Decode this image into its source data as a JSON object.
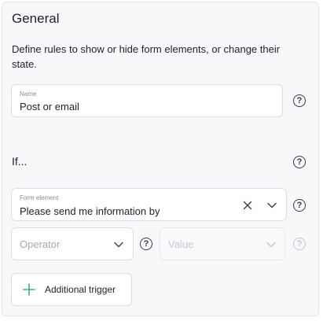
{
  "section": {
    "title": "General",
    "description": "Define rules to show or hide form elements, or change their state."
  },
  "name_field": {
    "label": "Name",
    "value": "Post or email"
  },
  "if_section": {
    "label": "If..."
  },
  "form_element_field": {
    "label": "Form element",
    "value": "Please send me information by"
  },
  "operator_field": {
    "placeholder": "Operator"
  },
  "value_field": {
    "placeholder": "Value"
  },
  "help_icon_glyph": "?",
  "additional_trigger_button": {
    "label": "Additional trigger"
  },
  "colors": {
    "panel_background": "#f8f8fb",
    "border": "#dcdce6",
    "text": "#1f1f2e",
    "plus_icon": "#3bb273"
  },
  "icons": [
    "help-icon",
    "clear-icon",
    "chevron-down-icon",
    "plus-icon"
  ]
}
